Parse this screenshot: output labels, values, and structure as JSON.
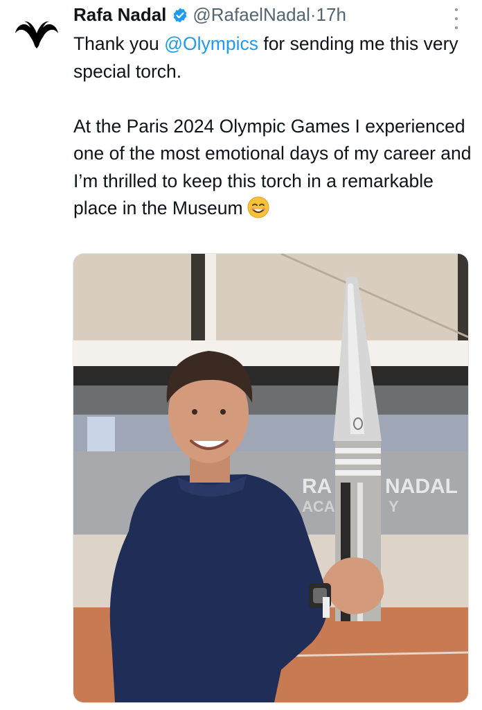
{
  "tweet": {
    "author_name": "Rafa Nadal",
    "handle": "@RafaelNadal",
    "separator": "·",
    "time": "17h",
    "text_part1": "Thank you ",
    "mention": "@Olympics",
    "text_part2": " for sending me this very special torch.\n\nAt the Paris 2024 Olympic Games I experienced one of the most emotional days of my career and I’m thrilled to keep this torch in a remarkable place in the Museum",
    "emoji_name": "smiling-face-emoji"
  },
  "media": {
    "sign_line1": "RA",
    "sign_line1b": "NADAL",
    "sign_line2": "ACA",
    "sign_line2b": "Y",
    "colors": {
      "sweater": "#1f2d57",
      "clay": "#c87a52",
      "torch": "#c9c9c9"
    }
  },
  "colors": {
    "link": "#1d9bf0",
    "muted": "#536471",
    "verified": "#1d9bf0"
  },
  "icons": [
    "rafa-nadal-logo-icon",
    "verified-badge-icon",
    "more-options-icon"
  ]
}
